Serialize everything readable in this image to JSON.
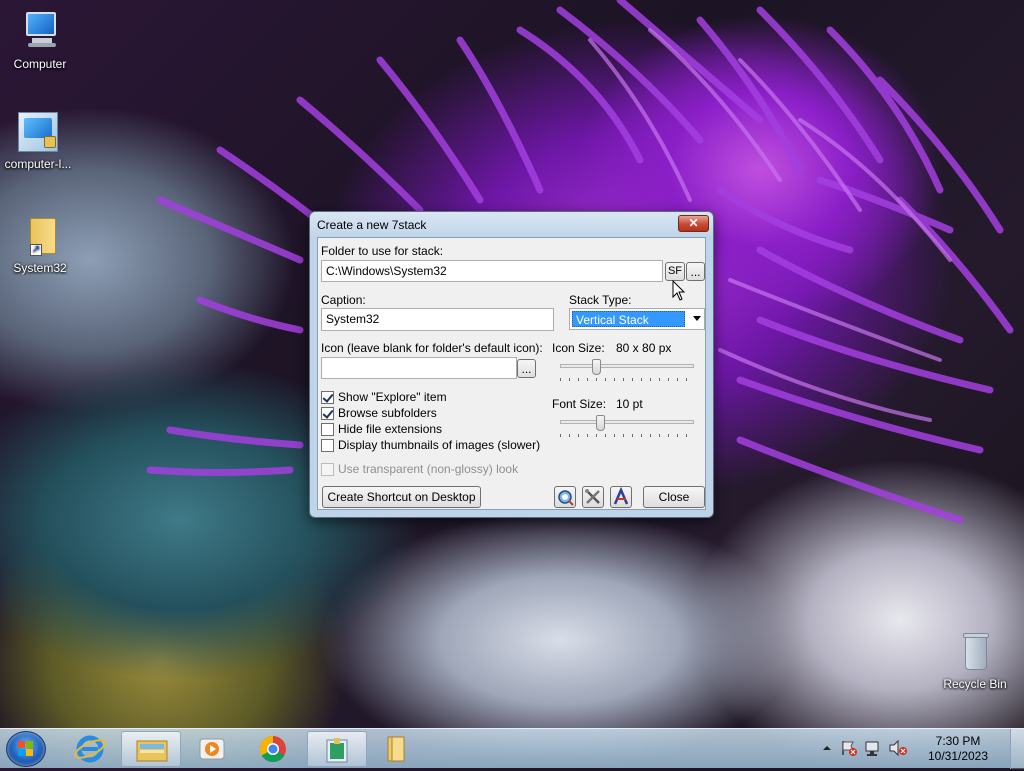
{
  "desktop": {
    "icons": [
      {
        "label": "Computer",
        "icon": "computer-icon"
      },
      {
        "label": "computer-l...",
        "icon": "locked-computer-icon"
      },
      {
        "label": "System32",
        "icon": "folder-shortcut-icon"
      },
      {
        "label": "Recycle Bin",
        "icon": "recycle-bin-icon"
      }
    ]
  },
  "dialog": {
    "title": "Create a new 7stack",
    "close_glyph": "✕",
    "folder_label": "Folder to use for stack:",
    "folder_value": "C:\\Windows\\System32",
    "sf_button": "SF",
    "browse_button": "...",
    "caption_label": "Caption:",
    "caption_value": "System32",
    "stack_type_label": "Stack Type:",
    "stack_type_value": "Vertical Stack",
    "icon_label": "Icon (leave blank for folder's default icon):",
    "icon_value": "",
    "icon_browse_button": "...",
    "icon_size_label": "Icon Size:",
    "icon_size_value": "80 x 80 px",
    "icon_size_fraction": 0.27,
    "font_size_label": "Font Size:",
    "font_size_value": "10 pt",
    "font_size_fraction": 0.3,
    "options": [
      {
        "label": "Show \"Explore\" item",
        "checked": true,
        "enabled": true
      },
      {
        "label": "Browse subfolders",
        "checked": true,
        "enabled": true
      },
      {
        "label": "Hide file extensions",
        "checked": false,
        "enabled": true
      },
      {
        "label": "Display thumbnails of images (slower)",
        "checked": false,
        "enabled": true
      },
      {
        "label": "Use transparent (non-glossy) look",
        "checked": false,
        "enabled": false
      }
    ],
    "create_shortcut_button": "Create Shortcut on Desktop",
    "tool_buttons": [
      "search-update-icon",
      "tools-icon",
      "about-icon"
    ],
    "close_button": "Close"
  },
  "taskbar": {
    "pinned": [
      "internet-explorer-icon",
      "file-explorer-icon",
      "media-player-icon",
      "chrome-icon",
      "7stack-icon",
      "folder-icon"
    ],
    "tray_icons": [
      "show-hidden-icons-icon",
      "action-center-icon",
      "network-icon",
      "volume-muted-icon"
    ],
    "time": "7:30 PM",
    "date": "10/31/2023"
  },
  "colors": {
    "selection": "#3399ff",
    "close_red": "#c74a34",
    "dialog_frame": "#bfd4e8"
  }
}
